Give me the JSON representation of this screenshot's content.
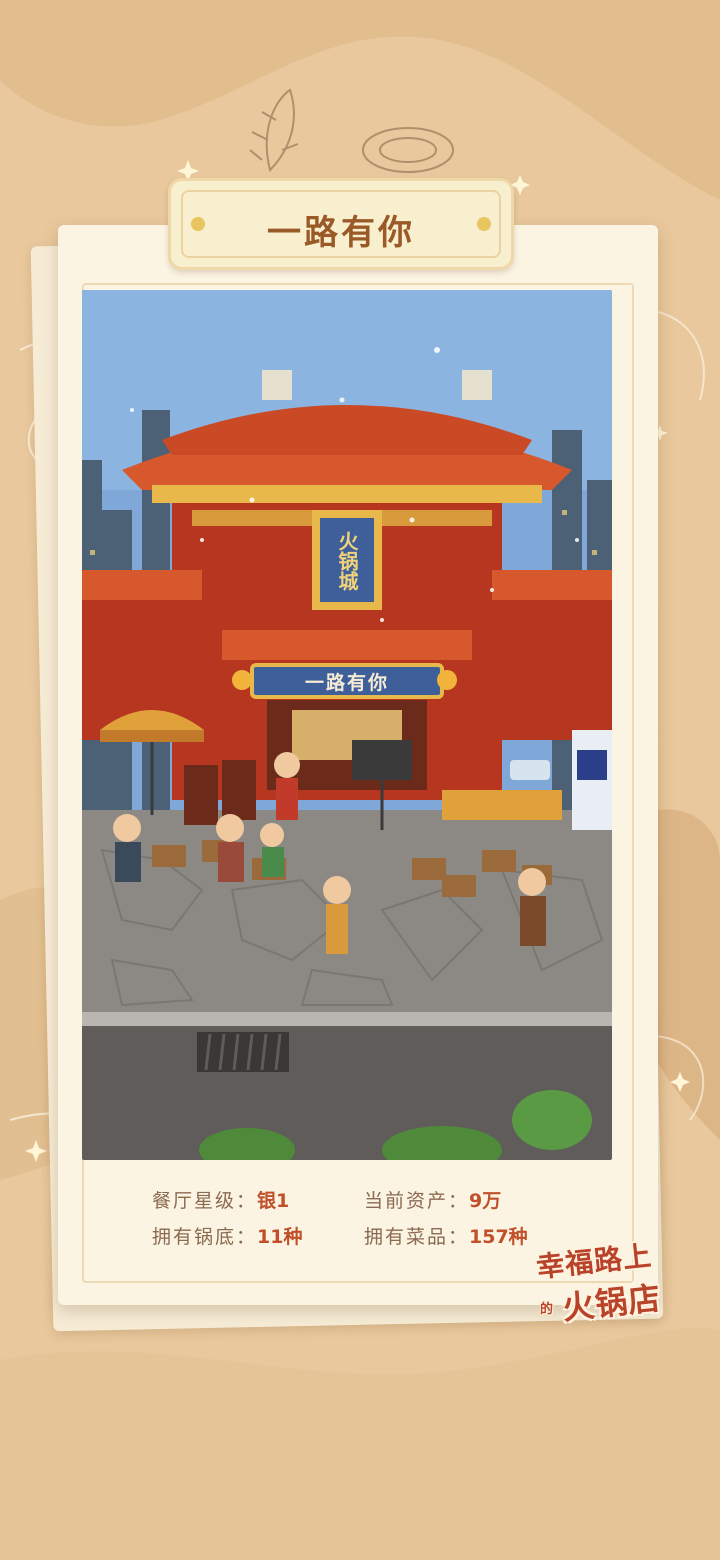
{
  "title": "一路有你",
  "scene": {
    "signboard_vertical": "火锅城",
    "signboard_banner": "一路有你"
  },
  "stats": [
    {
      "label": "餐厅星级：",
      "value": "银1"
    },
    {
      "label": "当前资产：",
      "value": "9万"
    },
    {
      "label": "拥有锅底：",
      "value": "11种"
    },
    {
      "label": "拥有菜品：",
      "value": "157种"
    }
  ],
  "logo": {
    "line1": "幸福路上",
    "small": "的",
    "line2": "火锅店"
  },
  "colors": {
    "background": "#e8c89c",
    "card": "#fbf4e3",
    "title_text": "#9a5a28",
    "stat_value": "#c0502a",
    "stat_label": "#8a6a50"
  }
}
